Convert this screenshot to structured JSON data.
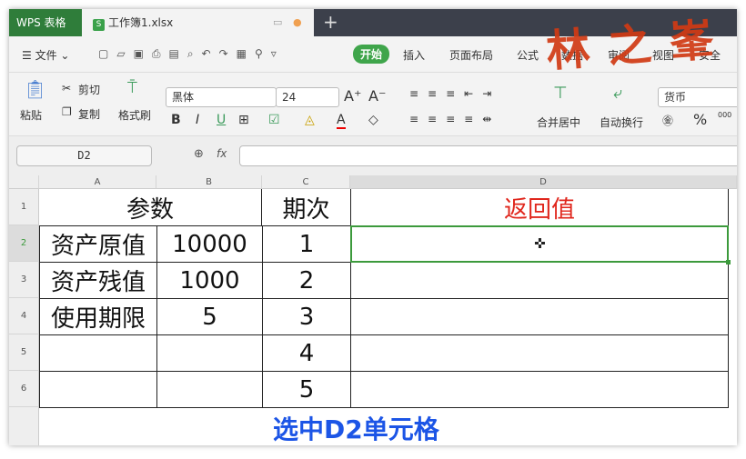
{
  "tabs": {
    "app": "WPS 表格",
    "doc_icon": "S",
    "doc": "工作簿1.xlsx",
    "new": "+"
  },
  "menu": {
    "file": "文件",
    "items": [
      "开始",
      "插入",
      "页面布局",
      "公式",
      "数据",
      "审阅",
      "视图",
      "安全"
    ]
  },
  "ribbon": {
    "paste": "粘贴",
    "cut": "剪切",
    "copy": "复制",
    "format_painter": "格式刷",
    "font": "黑体",
    "size": "24",
    "bold": "B",
    "italic": "I",
    "underline": "U",
    "merge": "合并居中",
    "wrap": "自动换行",
    "number_format": "货币",
    "percent": "%",
    "thousands": "000"
  },
  "formula": {
    "namebox": "D2",
    "fx": "fx",
    "value": ""
  },
  "columns": [
    "A",
    "B",
    "C",
    "D"
  ],
  "rows": [
    "1",
    "2",
    "3",
    "4",
    "5",
    "6"
  ],
  "cells": {
    "A1": "参数",
    "C1": "期次",
    "D1": "返回值",
    "A2": "资产原值",
    "B2": "10000",
    "C2": "1",
    "A3": "资产残值",
    "B3": "1000",
    "C3": "2",
    "A4": "使用期限",
    "B4": "5",
    "C4": "3",
    "C5": "4",
    "C6": "5"
  },
  "colors": {
    "accent": "#3fa54b",
    "d1": "#e0261c",
    "caption": "#1c55e6",
    "selection": "#3c9a3c"
  },
  "caption": "选中D2单元格",
  "watermark": "林之峯"
}
